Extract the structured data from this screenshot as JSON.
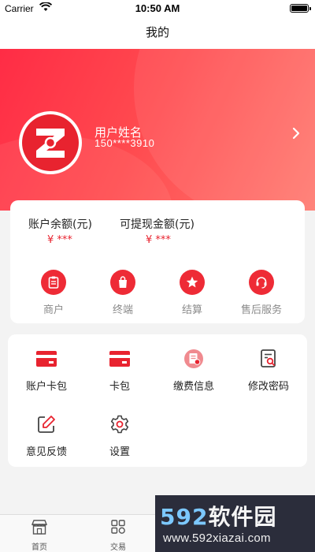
{
  "status_bar": {
    "carrier": "Carrier",
    "time": "10:50 AM"
  },
  "nav": {
    "title": "我的"
  },
  "profile": {
    "name": "用户姓名",
    "phone": "150****3910"
  },
  "balances": [
    {
      "label": "账户余额(元)",
      "value": "¥ ***"
    },
    {
      "label": "可提现金额(元)",
      "value": "¥ ***"
    }
  ],
  "quick_menu": [
    {
      "label": "商户",
      "icon": "clipboard-icon"
    },
    {
      "label": "终端",
      "icon": "shopping-bag-icon"
    },
    {
      "label": "结算",
      "icon": "star-icon"
    },
    {
      "label": "售后服务",
      "icon": "headset-icon"
    }
  ],
  "services": [
    {
      "label": "账户卡包",
      "icon": "card-icon"
    },
    {
      "label": "卡包",
      "icon": "card-icon"
    },
    {
      "label": "缴费信息",
      "icon": "bill-icon"
    },
    {
      "label": "修改密码",
      "icon": "document-search-icon"
    },
    {
      "label": "意见反馈",
      "icon": "edit-icon"
    },
    {
      "label": "设置",
      "icon": "gear-icon"
    }
  ],
  "tab_bar": [
    {
      "label": "首页",
      "icon": "store-icon"
    },
    {
      "label": "交易",
      "icon": "grid-icon"
    }
  ],
  "watermark": {
    "brand_number": "592",
    "brand_text": "软件园",
    "url": "www.592xiazai.com"
  },
  "colors": {
    "accent": "#ee2b36",
    "hero_start": "#ff2c45",
    "hero_end": "#ff7a70"
  }
}
